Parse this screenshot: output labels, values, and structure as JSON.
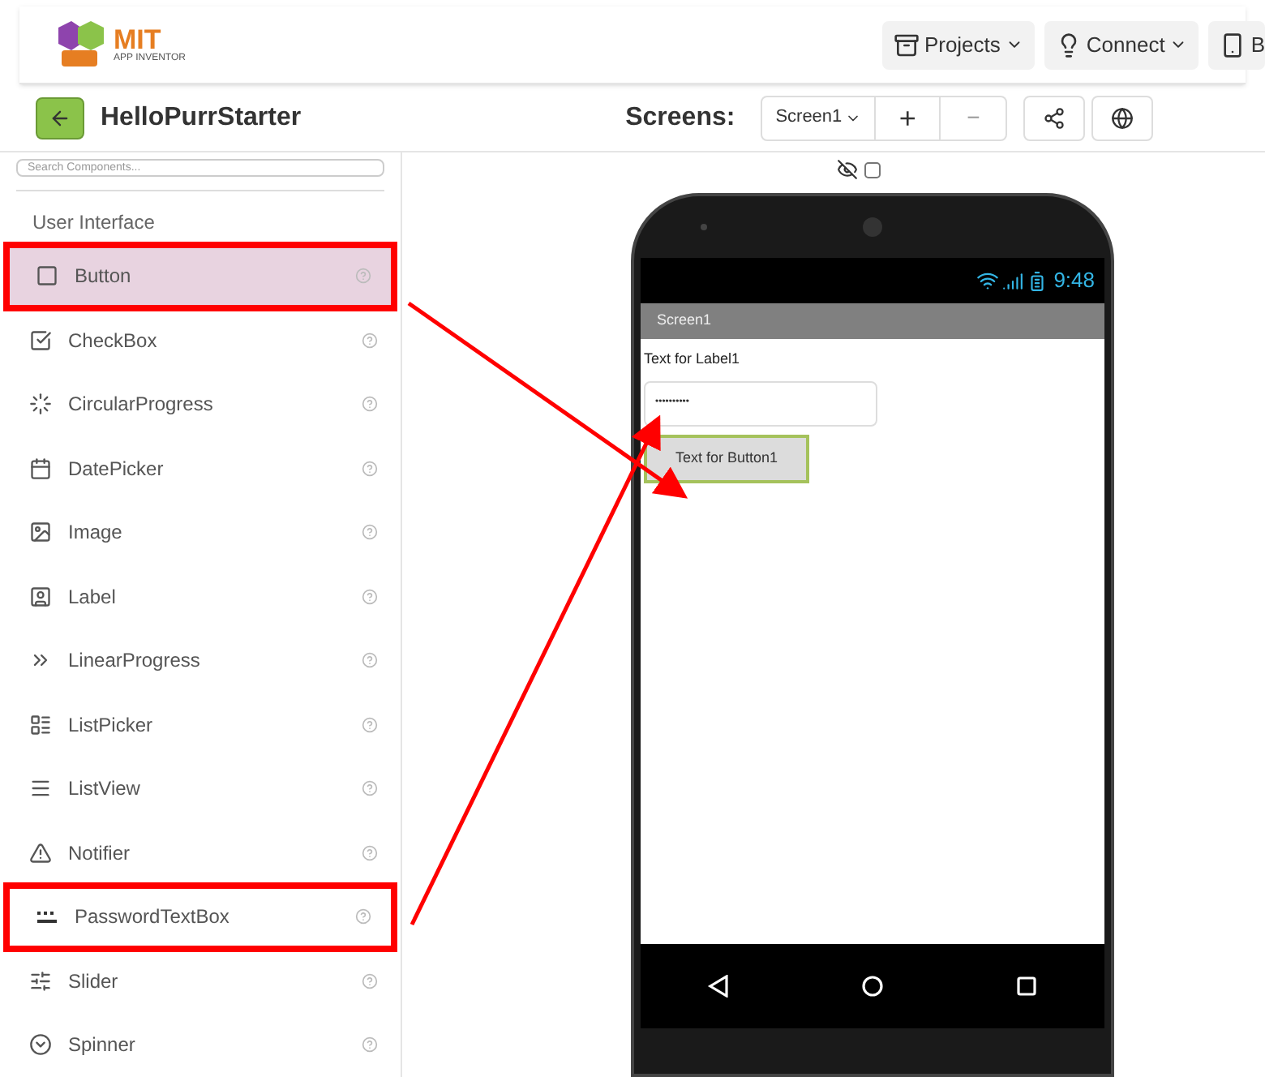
{
  "header": {
    "logo": {
      "title": "MIT",
      "subtitle": "APP INVENTOR"
    },
    "menu": [
      {
        "label": "Projects",
        "kind": "projects"
      },
      {
        "label": "Connect",
        "kind": "connect"
      },
      {
        "label": "B",
        "kind": "build"
      }
    ]
  },
  "toolbar": {
    "project_name": "HelloPurrStarter",
    "screens_label": "Screens:",
    "screen_dropdown": "Screen1",
    "add_button": "+",
    "remove_button": "−"
  },
  "palette": {
    "search": {
      "placeholder": "Search Components..."
    },
    "category": "User Interface",
    "items": [
      {
        "label": "Button",
        "selected": true,
        "annotated": true
      },
      {
        "label": "CheckBox",
        "selected": false,
        "annotated": false
      },
      {
        "label": "CircularProgress",
        "selected": false,
        "annotated": false
      },
      {
        "label": "DatePicker",
        "selected": false,
        "annotated": false
      },
      {
        "label": "Image",
        "selected": false,
        "annotated": false
      },
      {
        "label": "Label",
        "selected": false,
        "annotated": false
      },
      {
        "label": "LinearProgress",
        "selected": false,
        "annotated": false
      },
      {
        "label": "ListPicker",
        "selected": false,
        "annotated": false
      },
      {
        "label": "ListView",
        "selected": false,
        "annotated": false
      },
      {
        "label": "Notifier",
        "selected": false,
        "annotated": false
      },
      {
        "label": "PasswordTextBox",
        "selected": false,
        "annotated": true
      },
      {
        "label": "Slider",
        "selected": false,
        "annotated": false
      },
      {
        "label": "Spinner",
        "selected": false,
        "annotated": false
      }
    ]
  },
  "viewer": {
    "show_hidden_checked": false,
    "phone": {
      "time": "9:48",
      "title": "Screen1",
      "label": "Text for Label1",
      "password_value": "••••••••••",
      "button": "Text for Button1"
    }
  }
}
